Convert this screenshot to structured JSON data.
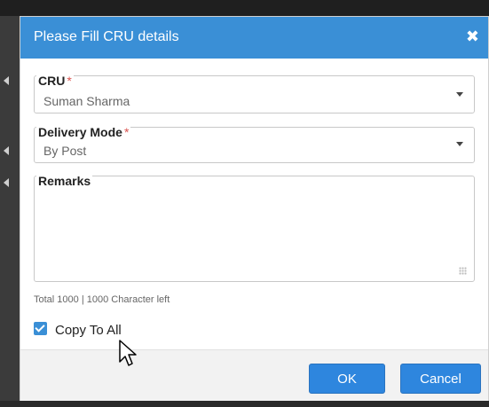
{
  "dialog": {
    "title": "Please Fill CRU details",
    "close_glyph": "✖",
    "cru": {
      "label": "CRU",
      "required_mark": "*",
      "value": "Suman Sharma"
    },
    "delivery_mode": {
      "label": "Delivery Mode",
      "required_mark": "*",
      "value": "By Post"
    },
    "remarks": {
      "label": "Remarks",
      "value": ""
    },
    "char_count": "Total 1000 | 1000 Character left",
    "copy_to_all": {
      "label": "Copy To All",
      "checked": true
    },
    "buttons": {
      "ok": "OK",
      "cancel": "Cancel"
    }
  },
  "colors": {
    "header": "#3a8fd6",
    "button": "#2e86de",
    "required": "#d9534f"
  },
  "icons": [
    "close-icon",
    "chevron-down-icon",
    "resize-icon",
    "checkmark-icon",
    "cursor-icon"
  ]
}
